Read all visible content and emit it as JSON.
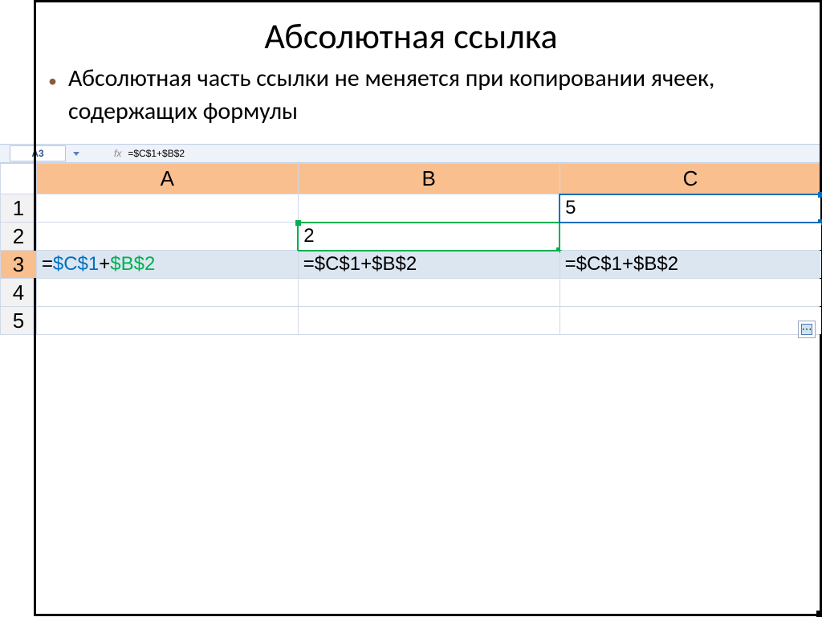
{
  "title": "Абсолютная ссылка",
  "bullet": "Абсолютная часть ссылки не меняется при копировании ячеек, содержащих формулы",
  "formulaBar": {
    "nameBox": "A3",
    "fx": "fx",
    "formula": "=$C$1+$B$2"
  },
  "columns": [
    "A",
    "B",
    "C"
  ],
  "rows": [
    "1",
    "2",
    "3",
    "4",
    "5"
  ],
  "cells": {
    "c1": "5",
    "b2": "2",
    "a3_eq": "=",
    "a3_r1": "$C$1",
    "a3_plus": "+",
    "a3_r2": "$B$2",
    "b3": "=$C$1+$B$2",
    "c3": "=$C$1+$B$2"
  }
}
